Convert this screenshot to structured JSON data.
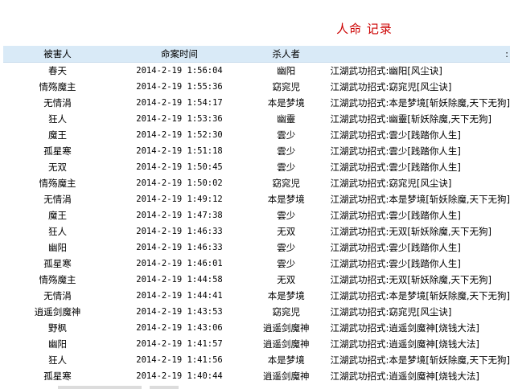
{
  "page": {
    "title": "人命 记录"
  },
  "table": {
    "headers": {
      "victim": "被害人",
      "time": "命案时间",
      "killer": "杀人者",
      "move_marker": ":"
    },
    "rows": [
      {
        "victim": "春天",
        "time": "2014-2-19 1:56:04",
        "killer": "幽阳",
        "move": "江湖武功招式:幽阳[风尘诀]"
      },
      {
        "victim": "情殇魔主",
        "time": "2014-2-19 1:55:36",
        "killer": "窈窕児",
        "move": "江湖武功招式:窈窕児[风尘诀]"
      },
      {
        "victim": "无情涓",
        "time": "2014-2-19 1:54:17",
        "killer": "本是梦境",
        "move": "江湖武功招式:本是梦境[斩妖除魔,天下无狗]"
      },
      {
        "victim": "狂人",
        "time": "2014-2-19 1:53:36",
        "killer": "幽靈",
        "move": "江湖武功招式:幽靈[斩妖除魔,天下无狗]"
      },
      {
        "victim": "魔王",
        "time": "2014-2-19 1:52:30",
        "killer": "雲少",
        "move": "江湖武功招式:雲少[践踏你人生]"
      },
      {
        "victim": "孤星寒",
        "time": "2014-2-19 1:51:18",
        "killer": "雲少",
        "move": "江湖武功招式:雲少[践踏你人生]"
      },
      {
        "victim": "无双",
        "time": "2014-2-19 1:50:45",
        "killer": "雲少",
        "move": "江湖武功招式:雲少[践踏你人生]"
      },
      {
        "victim": "情殇魔主",
        "time": "2014-2-19 1:50:02",
        "killer": "窈窕児",
        "move": "江湖武功招式:窈窕児[风尘诀]"
      },
      {
        "victim": "无情涓",
        "time": "2014-2-19 1:49:12",
        "killer": "本是梦境",
        "move": "江湖武功招式:本是梦境[斩妖除魔,天下无狗]"
      },
      {
        "victim": "魔王",
        "time": "2014-2-19 1:47:38",
        "killer": "雲少",
        "move": "江湖武功招式:雲少[践踏你人生]"
      },
      {
        "victim": "狂人",
        "time": "2014-2-19 1:46:33",
        "killer": "无双",
        "move": "江湖武功招式:无双[斩妖除魔,天下无狗]"
      },
      {
        "victim": "幽阳",
        "time": "2014-2-19 1:46:33",
        "killer": "雲少",
        "move": "江湖武功招式:雲少[践踏你人生]"
      },
      {
        "victim": "孤星寒",
        "time": "2014-2-19 1:46:01",
        "killer": "雲少",
        "move": "江湖武功招式:雲少[践踏你人生]"
      },
      {
        "victim": "情殇魔主",
        "time": "2014-2-19 1:44:58",
        "killer": "无双",
        "move": "江湖武功招式:无双[斩妖除魔,天下无狗]"
      },
      {
        "victim": "无情涓",
        "time": "2014-2-19 1:44:41",
        "killer": "本是梦境",
        "move": "江湖武功招式:本是梦境[斩妖除魔,天下无狗]"
      },
      {
        "victim": "逍遥剑魔神",
        "time": "2014-2-19 1:43:53",
        "killer": "窈窕児",
        "move": "江湖武功招式:窈窕児[风尘诀]"
      },
      {
        "victim": "野枫",
        "time": "2014-2-19 1:43:06",
        "killer": "逍遥剑魔神",
        "move": "江湖武功招式:逍遥剑魔神[烧钱大法]"
      },
      {
        "victim": "幽阳",
        "time": "2014-2-19 1:41:57",
        "killer": "逍遥剑魔神",
        "move": "江湖武功招式:逍遥剑魔神[烧钱大法]"
      },
      {
        "victim": "狂人",
        "time": "2014-2-19 1:41:56",
        "killer": "本是梦境",
        "move": "江湖武功招式:本是梦境[斩妖除魔,天下无狗]"
      },
      {
        "victim": "孤星寒",
        "time": "2014-2-19 1:40:44",
        "killer": "逍遥剑魔神",
        "move": "江湖武功招式:逍遥剑魔神[烧钱大法]"
      }
    ]
  },
  "colors": {
    "title": "#cc0000",
    "header_background": "#d9eaf7"
  }
}
